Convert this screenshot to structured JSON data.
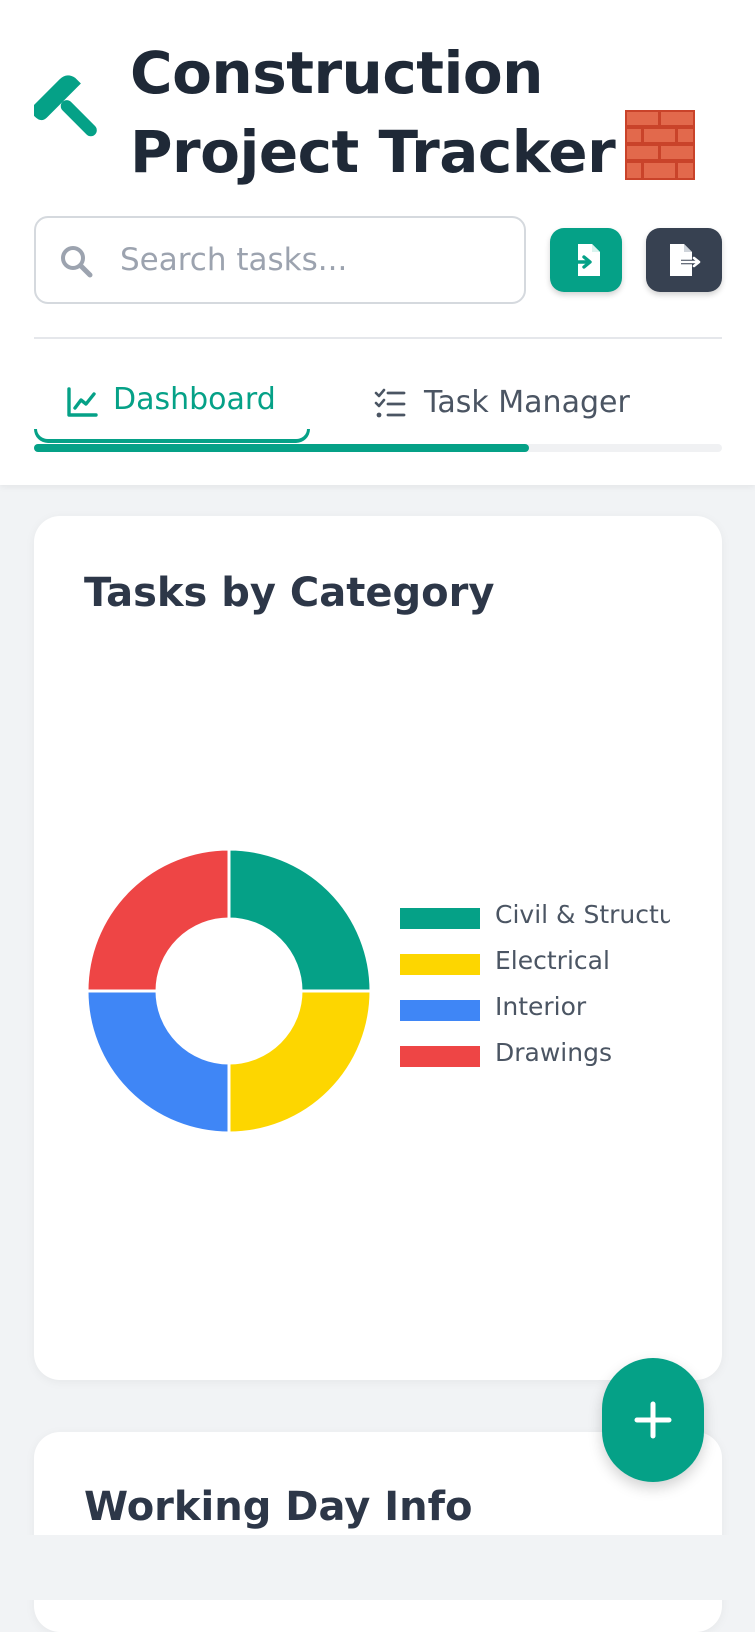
{
  "header": {
    "title": "Construction Project Tracker",
    "title_emoji": "brick-icon",
    "logo_icon": "hammer-icon"
  },
  "search": {
    "placeholder": "Search tasks...",
    "value": ""
  },
  "toolbar": {
    "import_icon": "file-import-icon",
    "export_icon": "file-export-icon"
  },
  "tabs": [
    {
      "label": "Dashboard",
      "icon": "chart-line-icon",
      "active": true
    },
    {
      "label": "Task Manager",
      "icon": "task-list-icon",
      "active": false
    }
  ],
  "tab_scroll_fraction": 0.72,
  "colors": {
    "accent": "#05a187",
    "dark_button": "#374151",
    "text_dark": "#1f2937"
  },
  "chart_card": {
    "title": "Tasks by Category"
  },
  "chart_data": {
    "type": "pie",
    "variant": "doughnut",
    "title": "",
    "legend_position": "right",
    "categories": [
      "Civil & Structural",
      "Electrical",
      "Interior",
      "Drawings"
    ],
    "legend_visible_labels": [
      "Civil & Structu",
      "Electrical",
      "Interior",
      "Drawings"
    ],
    "values": [
      1,
      1,
      1,
      1
    ],
    "colors": [
      "#05a187",
      "#fdd600",
      "#3f86f6",
      "#ee4545"
    ]
  },
  "working_day_card": {
    "title": "Working Day Info"
  },
  "fab": {
    "icon": "plus-icon"
  }
}
